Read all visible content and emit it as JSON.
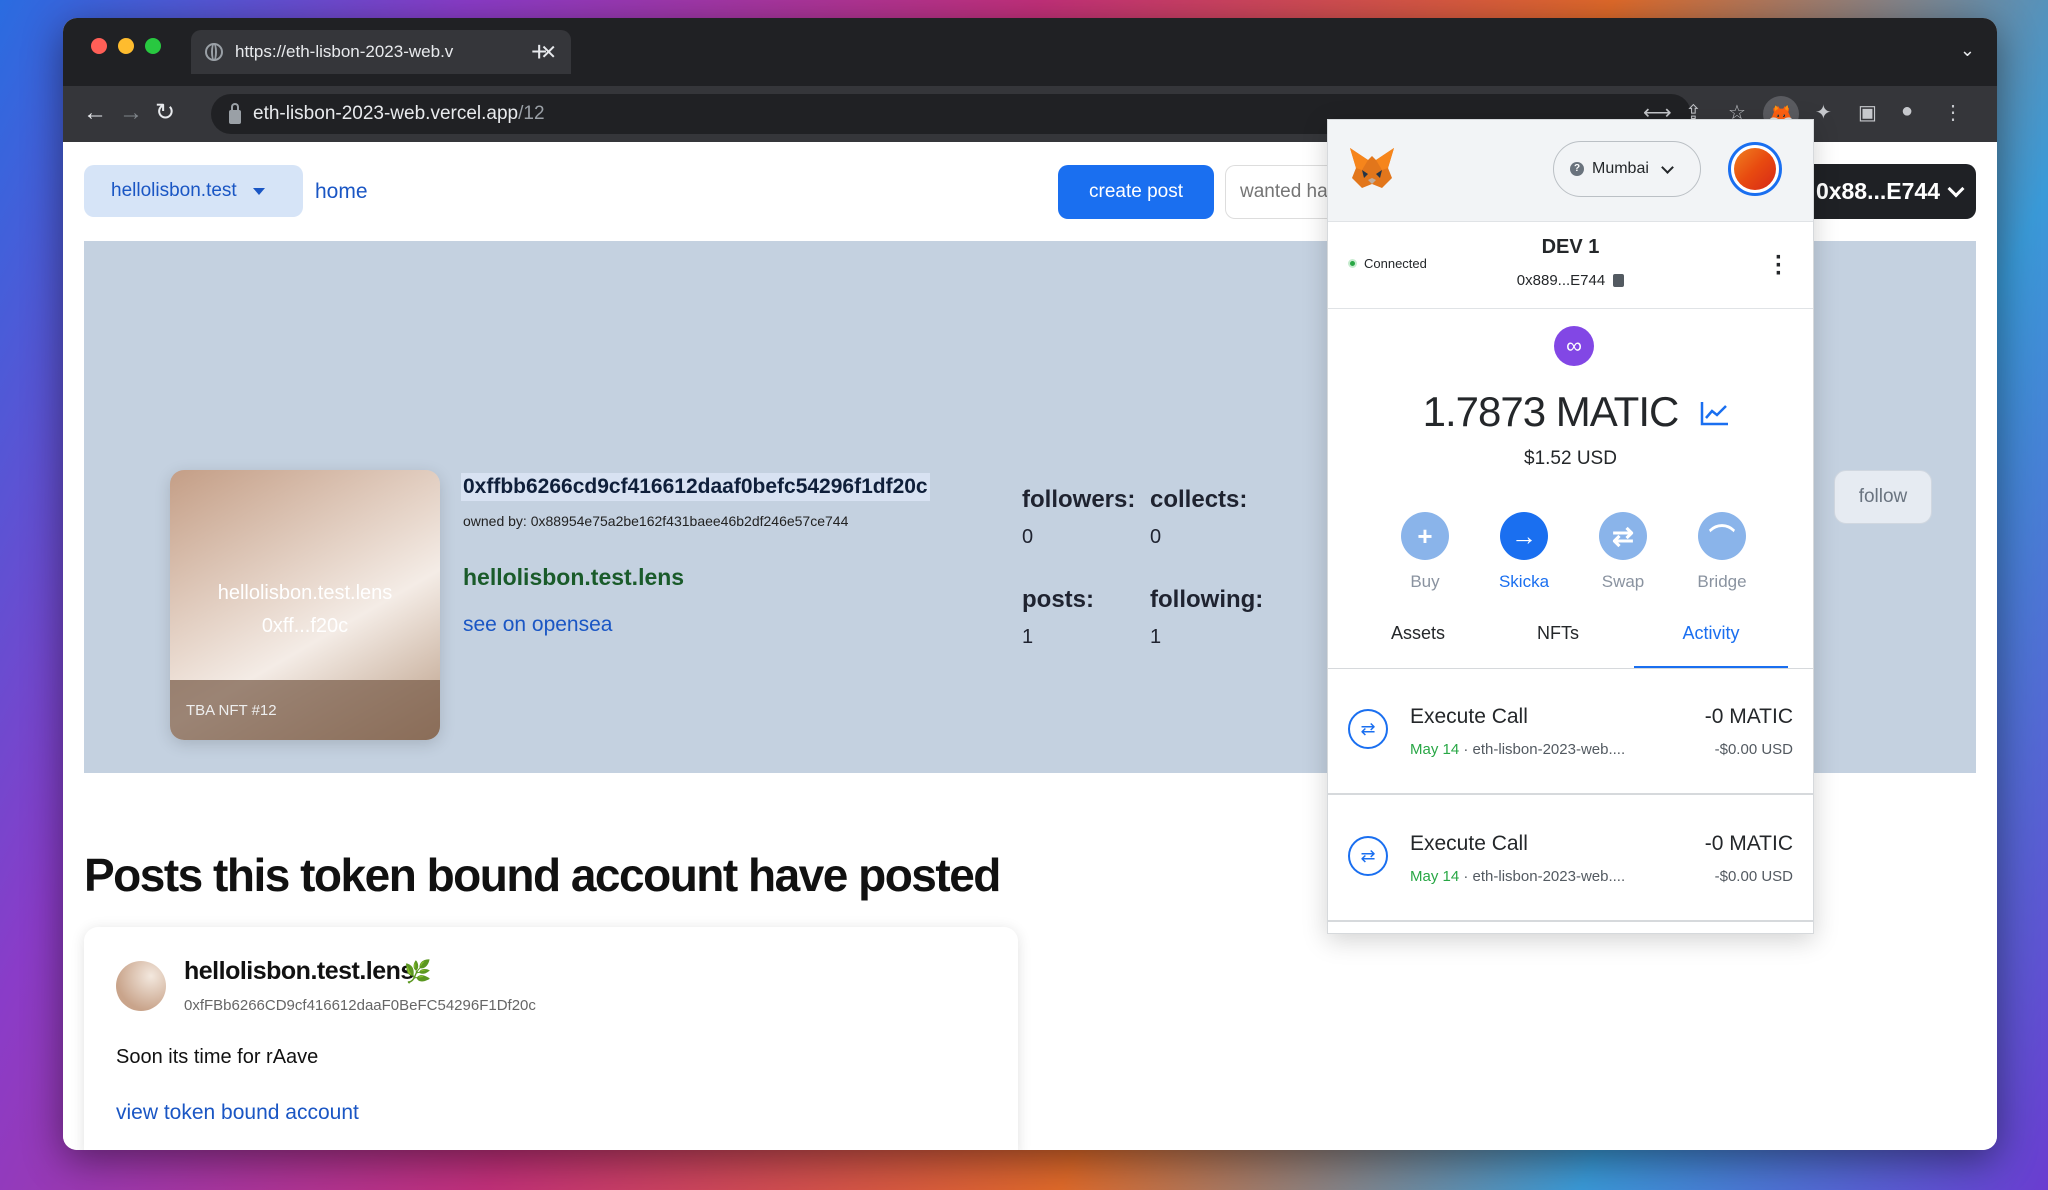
{
  "browser": {
    "tab_title": "https://eth-lisbon-2023-web.v",
    "new_tab": "+",
    "url_host": "eth-lisbon-2023-web.vercel.app",
    "url_path": "/12"
  },
  "nav": {
    "account_select": "hellolisbon.test",
    "home_link": "home",
    "create_post": "create post",
    "search_placeholder": "wanted ha",
    "wallet_address": "0x88...E744"
  },
  "profile": {
    "nft_name_line1": "hellolisbon.test.lens",
    "nft_name_line2": "0xff...f20c",
    "nft_footer": "TBA NFT #12",
    "token_address": "0xffbb6266cd9cf416612daaf0befc54296f1df20c",
    "owned_by": "owned by: 0x88954e75a2be162f431baee46b2df246e57ce744",
    "lens_handle": "hellolisbon.test.lens",
    "opensea_link": "see on opensea",
    "stats": [
      {
        "label": "followers:",
        "value": "0"
      },
      {
        "label": "collects:",
        "value": "0"
      },
      {
        "label": "posts:",
        "value": "1"
      },
      {
        "label": "following:",
        "value": "1"
      }
    ],
    "follow_button": "follow"
  },
  "posts": {
    "heading": "Posts this token bound account have posted",
    "items": [
      {
        "author": "hellolisbon.test.lens",
        "address": "0xfFBb6266CD9cf416612daaF0BeFC54296F1Df20c",
        "text": "Soon its time for rAave",
        "link": "view token bound account"
      }
    ]
  },
  "metamask": {
    "network": "Mumbai",
    "connected_label": "Connected",
    "account_name": "DEV 1",
    "account_address": "0x889...E744",
    "balance": "1.7873 MATIC",
    "balance_usd": "$1.52 USD",
    "actions": [
      {
        "label": "Buy",
        "icon": "plus-icon",
        "color": "#8ab4ea"
      },
      {
        "label": "Skicka",
        "icon": "arrow-right-icon",
        "color": "#1a6ff0"
      },
      {
        "label": "Swap",
        "icon": "swap-icon",
        "color": "#8ab4ea"
      },
      {
        "label": "Bridge",
        "icon": "bridge-icon",
        "color": "#8ab4ea"
      }
    ],
    "tabs": [
      "Assets",
      "NFTs",
      "Activity"
    ],
    "active_tab": "Activity",
    "activity": [
      {
        "title": "Execute Call",
        "date": "May 14",
        "origin": "eth-lisbon-2023-web....",
        "amount": "-0 MATIC",
        "usd": "-$0.00 USD"
      },
      {
        "title": "Execute Call",
        "date": "May 14",
        "origin": "eth-lisbon-2023-web....",
        "amount": "-0 MATIC",
        "usd": "-$0.00 USD"
      }
    ]
  },
  "colors": {
    "accent": "#1a6ff0",
    "profile_bg": "#c4d1e0",
    "lens_green": "#1a5b2a",
    "metamask_purple": "#8247e5"
  }
}
